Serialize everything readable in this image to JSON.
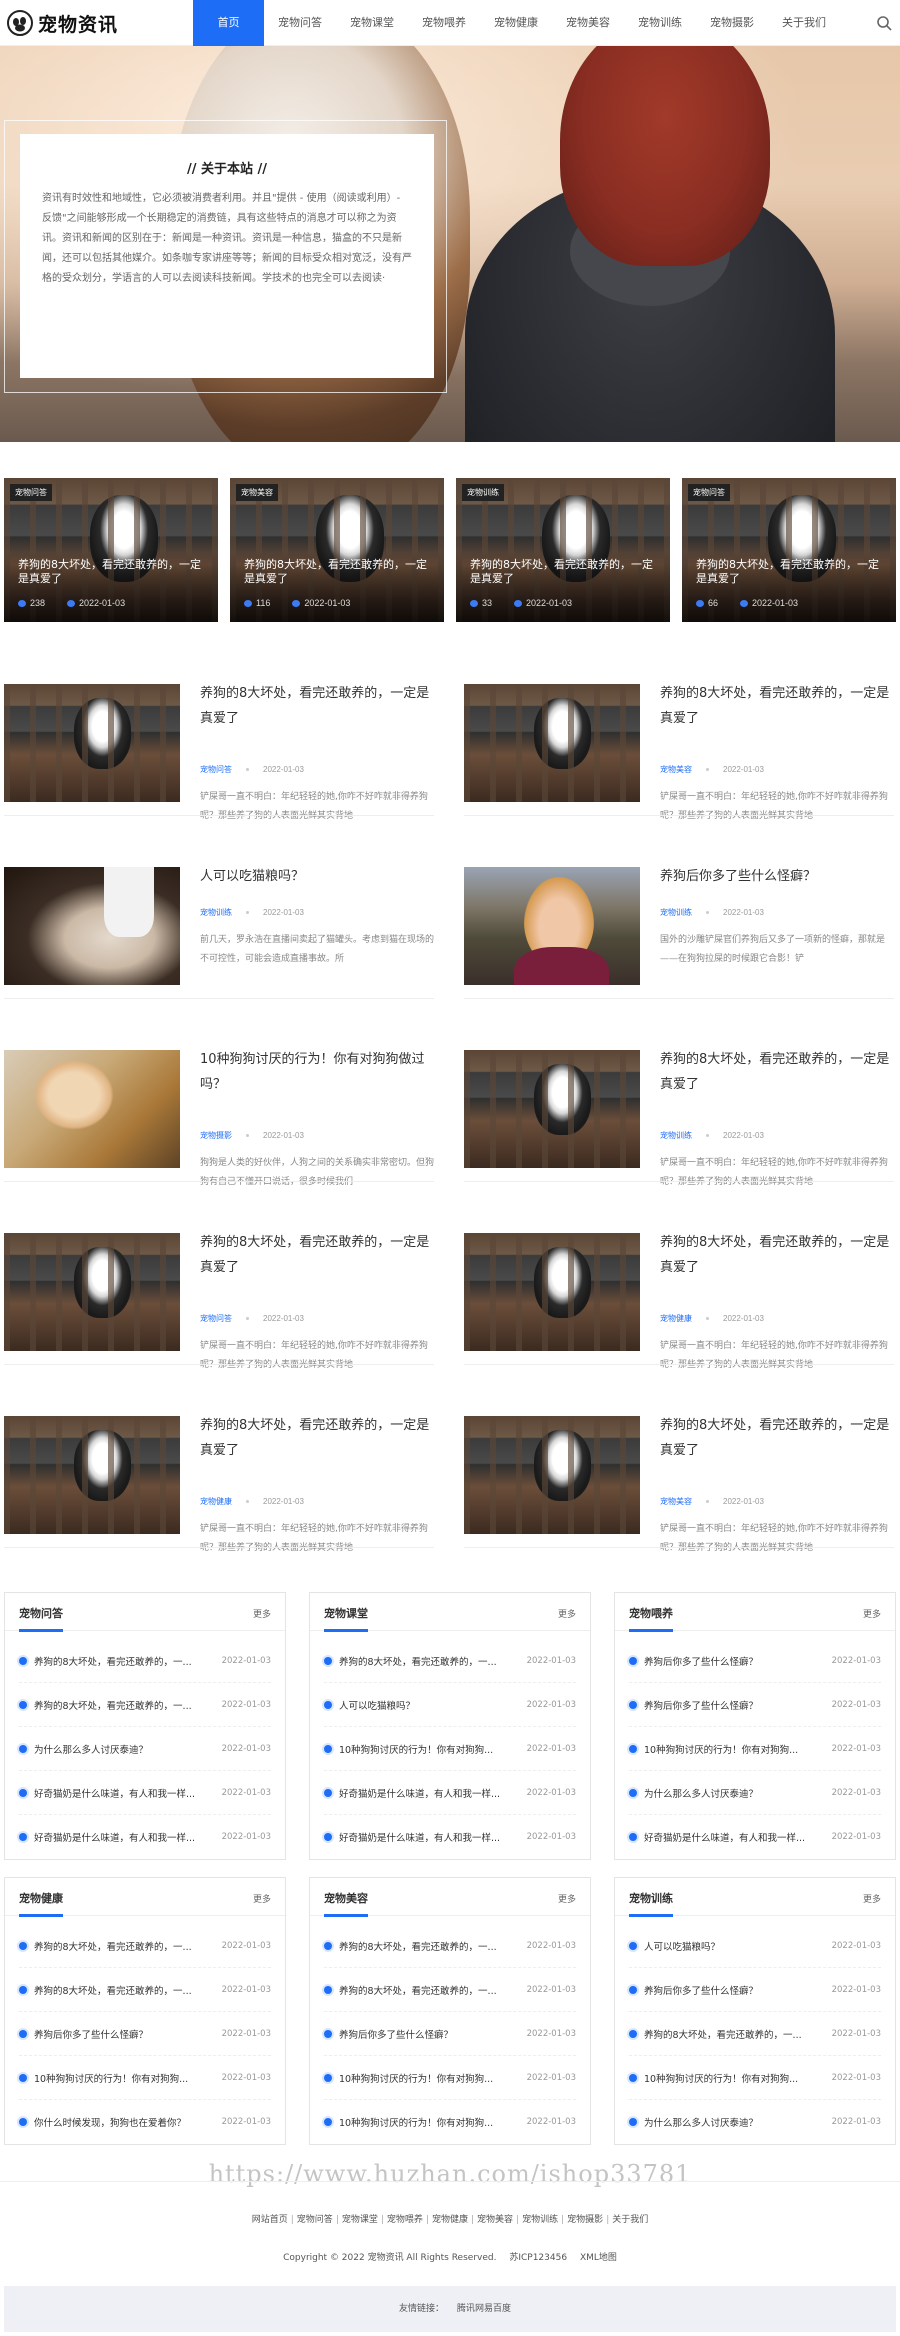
{
  "site": {
    "name": "宠物资讯"
  },
  "nav": [
    {
      "label": "首页",
      "active": true
    },
    {
      "label": "宠物问答"
    },
    {
      "label": "宠物课堂"
    },
    {
      "label": "宠物喂养"
    },
    {
      "label": "宠物健康"
    },
    {
      "label": "宠物美容"
    },
    {
      "label": "宠物训练"
    },
    {
      "label": "宠物摄影"
    },
    {
      "label": "关于我们"
    }
  ],
  "about": {
    "title": "// 关于本站 //",
    "text": "资讯有时效性和地域性，它必须被消费者利用。并且\"提供 - 使用（阅读或利用）- 反馈\"之间能够形成一个长期稳定的消费链，具有这些特点的消息才可以称之为资讯。资讯和新闻的区别在于：新闻是一种资讯。资讯是一种信息，猫盒的不只是新闻，还可以包括其他媒介。如条咖专家讲座等等；新闻的目标受众相对宽泛，没有严格的受众划分，学语言的人可以去阅读科技新闻。学技术的也完全可以去阅读·"
  },
  "featured": [
    {
      "tag": "宠物问答",
      "title": "养狗的8大坏处，看完还敢养的，一定是真爱了",
      "views": "238",
      "date": "2022-01-03"
    },
    {
      "tag": "宠物美容",
      "title": "养狗的8大坏处，看完还敢养的，一定是真爱了",
      "views": "116",
      "date": "2022-01-03"
    },
    {
      "tag": "宠物训练",
      "title": "养狗的8大坏处，看完还敢养的，一定是真爱了",
      "views": "33",
      "date": "2022-01-03"
    },
    {
      "tag": "宠物问答",
      "title": "养狗的8大坏处，看完还敢养的，一定是真爱了",
      "views": "66",
      "date": "2022-01-03"
    }
  ],
  "articles": [
    {
      "img": "husky",
      "title": "养狗的8大坏处，看完还敢养的，一定是真爱了",
      "cat": "宠物问答",
      "date": "2022-01-03",
      "desc": "铲屎哥一直不明白：年纪轻轻的她,你咋不好咋就非得养狗呢？那些养了狗的人表面光鲜其实背地"
    },
    {
      "img": "husky",
      "title": "养狗的8大坏处，看完还敢养的，一定是真爱了",
      "cat": "宠物美容",
      "date": "2022-01-03",
      "desc": "铲屎哥一直不明白：年纪轻轻的她,你咋不好咋就非得养狗呢？那些养了狗的人表面光鲜其实背地"
    },
    {
      "img": "cat",
      "title": "人可以吃猫粮吗？",
      "cat": "宠物训练",
      "date": "2022-01-03",
      "desc": "前几天，罗永浩在直播间卖起了猫罐头。考虑到猫在现场的不可控性，可能会造成直播事故。所"
    },
    {
      "img": "girl",
      "title": "养狗后你多了些什么怪癖？",
      "cat": "宠物训练",
      "date": "2022-01-03",
      "desc": "国外的沙雕铲屎官们养狗后又多了一项新的怪癖，那就是——在狗狗拉屎的时候跟它合影！铲"
    },
    {
      "img": "golden",
      "title": "10种狗狗讨厌的行为！你有对狗狗做过吗？",
      "cat": "宠物摄影",
      "date": "2022-01-03",
      "desc": "狗狗是人类的好伙伴，人狗之间的关系确实非常密切。但狗狗有自己不懂开口说话，很多时候我们"
    },
    {
      "img": "husky",
      "title": "养狗的8大坏处，看完还敢养的，一定是真爱了",
      "cat": "宠物训练",
      "date": "2022-01-03",
      "desc": "铲屎哥一直不明白：年纪轻轻的她,你咋不好咋就非得养狗呢？那些养了狗的人表面光鲜其实背地"
    },
    {
      "img": "husky",
      "title": "养狗的8大坏处，看完还敢养的，一定是真爱了",
      "cat": "宠物问答",
      "date": "2022-01-03",
      "desc": "铲屎哥一直不明白：年纪轻轻的她,你咋不好咋就非得养狗呢？那些养了狗的人表面光鲜其实背地"
    },
    {
      "img": "husky",
      "title": "养狗的8大坏处，看完还敢养的，一定是真爱了",
      "cat": "宠物健康",
      "date": "2022-01-03",
      "desc": "铲屎哥一直不明白：年纪轻轻的她,你咋不好咋就非得养狗呢？那些养了狗的人表面光鲜其实背地"
    },
    {
      "img": "husky",
      "title": "养狗的8大坏处，看完还敢养的，一定是真爱了",
      "cat": "宠物健康",
      "date": "2022-01-03",
      "desc": "铲屎哥一直不明白：年纪轻轻的她,你咋不好咋就非得养狗呢？那些养了狗的人表面光鲜其实背地"
    },
    {
      "img": "husky",
      "title": "养狗的8大坏处，看完还敢养的，一定是真爱了",
      "cat": "宠物美容",
      "date": "2022-01-03",
      "desc": "铲屎哥一直不明白：年纪轻轻的她,你咋不好咋就非得养狗呢？那些养了狗的人表面光鲜其实背地"
    }
  ],
  "boxes": [
    {
      "title": "宠物问答",
      "more": "更多",
      "items": [
        {
          "t": "养狗的8大坏处，看完还敢养的，一...",
          "d": "2022-01-03"
        },
        {
          "t": "养狗的8大坏处，看完还敢养的，一...",
          "d": "2022-01-03"
        },
        {
          "t": "为什么那么多人讨厌泰迪？",
          "d": "2022-01-03"
        },
        {
          "t": "好奇猫奶是什么味道，有人和我一样...",
          "d": "2022-01-03"
        },
        {
          "t": "好奇猫奶是什么味道，有人和我一样...",
          "d": "2022-01-03"
        }
      ]
    },
    {
      "title": "宠物课堂",
      "more": "更多",
      "items": [
        {
          "t": "养狗的8大坏处，看完还敢养的，一...",
          "d": "2022-01-03"
        },
        {
          "t": "人可以吃猫粮吗？",
          "d": "2022-01-03"
        },
        {
          "t": "10种狗狗讨厌的行为！你有对狗狗...",
          "d": "2022-01-03"
        },
        {
          "t": "好奇猫奶是什么味道，有人和我一样...",
          "d": "2022-01-03"
        },
        {
          "t": "好奇猫奶是什么味道，有人和我一样...",
          "d": "2022-01-03"
        }
      ]
    },
    {
      "title": "宠物喂养",
      "more": "更多",
      "items": [
        {
          "t": "养狗后你多了些什么怪癖？",
          "d": "2022-01-03"
        },
        {
          "t": "养狗后你多了些什么怪癖？",
          "d": "2022-01-03"
        },
        {
          "t": "10种狗狗讨厌的行为！你有对狗狗...",
          "d": "2022-01-03"
        },
        {
          "t": "为什么那么多人讨厌泰迪？",
          "d": "2022-01-03"
        },
        {
          "t": "好奇猫奶是什么味道，有人和我一样...",
          "d": "2022-01-03"
        }
      ]
    },
    {
      "title": "宠物健康",
      "more": "更多",
      "items": [
        {
          "t": "养狗的8大坏处，看完还敢养的，一...",
          "d": "2022-01-03"
        },
        {
          "t": "养狗的8大坏处，看完还敢养的，一...",
          "d": "2022-01-03"
        },
        {
          "t": "养狗后你多了些什么怪癖？",
          "d": "2022-01-03"
        },
        {
          "t": "10种狗狗讨厌的行为！你有对狗狗...",
          "d": "2022-01-03"
        },
        {
          "t": "你什么时候发现，狗狗也在爱着你？",
          "d": "2022-01-03"
        }
      ]
    },
    {
      "title": "宠物美容",
      "more": "更多",
      "items": [
        {
          "t": "养狗的8大坏处，看完还敢养的，一...",
          "d": "2022-01-03"
        },
        {
          "t": "养狗的8大坏处，看完还敢养的，一...",
          "d": "2022-01-03"
        },
        {
          "t": "养狗后你多了些什么怪癖？",
          "d": "2022-01-03"
        },
        {
          "t": "10种狗狗讨厌的行为！你有对狗狗...",
          "d": "2022-01-03"
        },
        {
          "t": "10种狗狗讨厌的行为！你有对狗狗...",
          "d": "2022-01-03"
        }
      ]
    },
    {
      "title": "宠物训练",
      "more": "更多",
      "items": [
        {
          "t": "人可以吃猫粮吗？",
          "d": "2022-01-03"
        },
        {
          "t": "养狗后你多了些什么怪癖？",
          "d": "2022-01-03"
        },
        {
          "t": "养狗的8大坏处，看完还敢养的，一...",
          "d": "2022-01-03"
        },
        {
          "t": "10种狗狗讨厌的行为！你有对狗狗...",
          "d": "2022-01-03"
        },
        {
          "t": "为什么那么多人讨厌泰迪？",
          "d": "2022-01-03"
        }
      ]
    }
  ],
  "watermark": "https://www.huzhan.com/ishop33781",
  "footer": {
    "nav": [
      "网站首页",
      "宠物问答",
      "宠物课堂",
      "宠物喂养",
      "宠物健康",
      "宠物美容",
      "宠物训练",
      "宠物摄影",
      "关于我们"
    ],
    "copyright": "Copyright © 2022 宠物资讯 All Rights Reserved.",
    "icp": "苏ICP123456",
    "sitemap": "XML地图",
    "links_label": "友情链接：",
    "links": [
      "腾讯",
      "网易",
      "百度"
    ]
  },
  "colors": {
    "accent": "#1e6df6"
  }
}
